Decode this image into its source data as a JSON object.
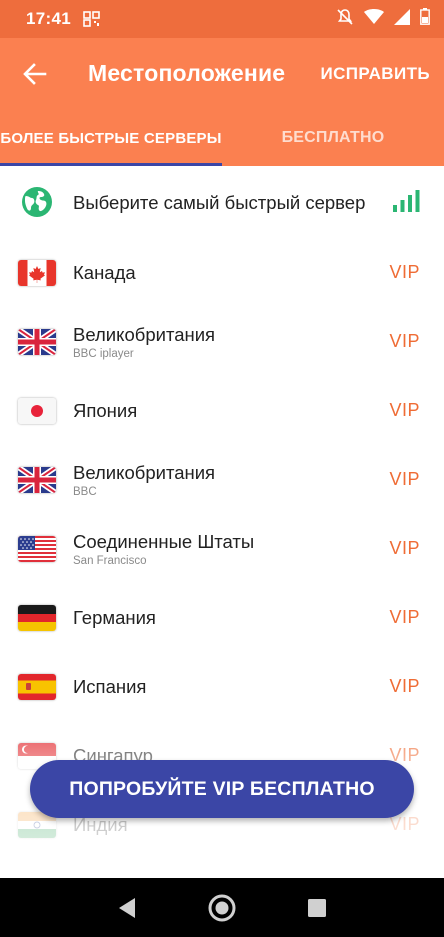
{
  "status_bar": {
    "time": "17:41",
    "icons": [
      "qr-scan-icon",
      "silent-icon",
      "wifi-icon",
      "signal-icon",
      "battery-icon"
    ]
  },
  "app_bar": {
    "title": "Местоположение",
    "edit_label": "ИСПРАВИТЬ",
    "back_icon": "arrow-left-icon"
  },
  "tabs": [
    {
      "label": "БОЛЕЕ БЫСТРЫЕ СЕРВЕРЫ",
      "selected": true
    },
    {
      "label": "БЕСПЛАТНО",
      "selected": false
    }
  ],
  "servers": [
    {
      "title": "Выберите самый быстрый сервер",
      "subtitle": "",
      "badge": "",
      "icon": "globe-icon"
    },
    {
      "title": "Канада",
      "subtitle": "",
      "badge": "VIP",
      "icon": "canada-flag-icon"
    },
    {
      "title": "Великобритания",
      "subtitle": "BBC iplayer",
      "badge": "VIP",
      "icon": "uk-flag-icon"
    },
    {
      "title": "Япония",
      "subtitle": "",
      "badge": "VIP",
      "icon": "japan-flag-icon"
    },
    {
      "title": "Великобритания",
      "subtitle": "BBC",
      "badge": "VIP",
      "icon": "uk-flag-icon"
    },
    {
      "title": "Соединенные Штаты",
      "subtitle": "San Francisco",
      "badge": "VIP",
      "icon": "us-flag-icon"
    },
    {
      "title": "Германия",
      "subtitle": "",
      "badge": "VIP",
      "icon": "germany-flag-icon"
    },
    {
      "title": "Испания",
      "subtitle": "",
      "badge": "VIP",
      "icon": "spain-flag-icon"
    },
    {
      "title": "Сингапур",
      "subtitle": "",
      "badge": "VIP",
      "icon": "singapore-flag-icon"
    },
    {
      "title": "Индия",
      "subtitle": "",
      "badge": "VIP",
      "icon": "india-flag-icon"
    }
  ],
  "cta": {
    "label": "ПОПРОБУЙТЕ VIP БЕСПЛАТНО"
  },
  "colors": {
    "app_bar": "#fb8050",
    "status_bar": "#ee6d3d",
    "accent": "#3b46a6",
    "vip": "#ef6c35",
    "signal_green": "#2bb673"
  }
}
